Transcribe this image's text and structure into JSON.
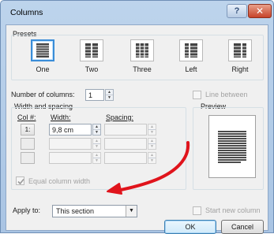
{
  "window": {
    "title": "Columns"
  },
  "titlebar": {
    "help_label": "?",
    "close_label": "✕"
  },
  "presets": {
    "heading": "Presets",
    "items": [
      {
        "label": "One",
        "icon": "one-column-icon",
        "selected": true
      },
      {
        "label": "Two",
        "icon": "two-column-icon",
        "selected": false
      },
      {
        "label": "Three",
        "icon": "three-column-icon",
        "selected": false
      },
      {
        "label": "Left",
        "icon": "left-column-icon",
        "selected": false
      },
      {
        "label": "Right",
        "icon": "right-column-icon",
        "selected": false
      }
    ]
  },
  "columns": {
    "label": "Number of columns:",
    "value": "1"
  },
  "line_between": {
    "label": "Line between",
    "checked": false,
    "enabled": false
  },
  "width_spacing": {
    "heading": "Width and spacing",
    "col_header": "Col #:",
    "width_header": "Width:",
    "spacing_header": "Spacing:",
    "rows": [
      {
        "col": "1:",
        "width": "9,8 cm",
        "spacing": ""
      },
      {
        "col": "",
        "width": "",
        "spacing": ""
      },
      {
        "col": "",
        "width": "",
        "spacing": ""
      }
    ]
  },
  "equal_width": {
    "label": "Equal column width",
    "checked": true,
    "enabled": false
  },
  "preview": {
    "heading": "Preview"
  },
  "apply_to": {
    "label": "Apply to:",
    "value": "This section"
  },
  "start_new_column": {
    "label": "Start new column",
    "checked": false,
    "enabled": false
  },
  "buttons": {
    "ok": "OK",
    "cancel": "Cancel"
  },
  "colors": {
    "accent": "#3a8dd8",
    "annotation_arrow": "#e0141c"
  }
}
